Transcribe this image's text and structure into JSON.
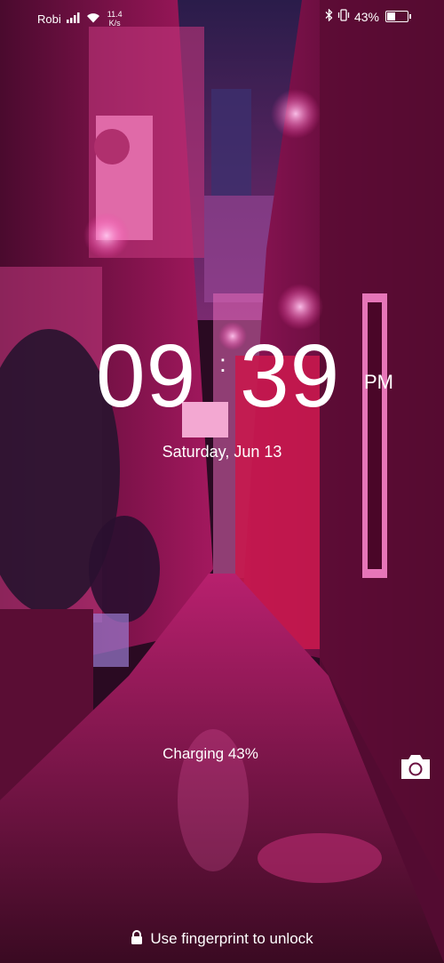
{
  "status_bar": {
    "carrier": "Robi",
    "net_speed_value": "11.4",
    "net_speed_unit": "K/s",
    "battery_percent_label": "43%",
    "battery_level": 0.43,
    "icons": [
      "signal-icon",
      "wifi-icon",
      "bluetooth-icon",
      "vibrate-icon",
      "battery-icon"
    ]
  },
  "clock": {
    "hours": "09",
    "separator": ":",
    "minutes": "39",
    "period": "PM"
  },
  "date": "Saturday, Jun 13",
  "charging_text": "Charging 43%",
  "unlock_hint": "Use fingerprint to unlock",
  "colors": {
    "neon_magenta": "#e0208a",
    "deep_shadow": "#2a0a22",
    "sky": "#3a1e55"
  }
}
